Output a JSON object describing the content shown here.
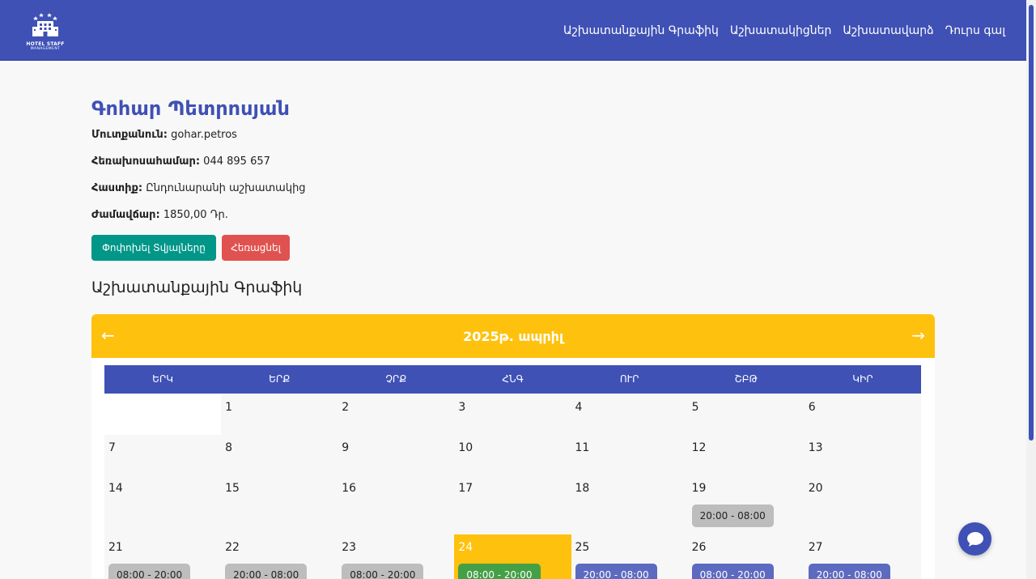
{
  "nav": {
    "logo_name": "HOTEL STAFF",
    "logo_sub": "MANAGEMENT",
    "links": [
      "Աշխատանքային Գրաֆիկ",
      "Աշխատակիցներ",
      "Աշխատավարձ",
      "Դուրս գալ"
    ]
  },
  "profile": {
    "name": "Գոհար Պետրոսյան",
    "fields": [
      {
        "label": "Մուտքանուն:",
        "value": "gohar.petros"
      },
      {
        "label": "Հեռախոսահամար:",
        "value": "044 895 657"
      },
      {
        "label": "Հաստիք:",
        "value": "Ընդունարանի աշխատակից"
      },
      {
        "label": "Ժամավճար:",
        "value": "1850,00 Դր."
      }
    ],
    "edit_label": "Փոփոխել Տվյալները",
    "delete_label": "Հեռացնել"
  },
  "schedule": {
    "section_title": "Աշխատանքային Գրաֆիկ",
    "month_label": "2025թ. ապրիլ",
    "prev_icon": "←",
    "next_icon": "→",
    "weekdays": [
      "ԵՐԿ",
      "ԵՐՔ",
      "ՉՐՔ",
      "ՀՆԳ",
      "ՈՒՐ",
      "ՇԲԹ",
      "ԿԻՐ"
    ],
    "days": [
      {
        "day": "",
        "empty": true
      },
      {
        "day": "1"
      },
      {
        "day": "2"
      },
      {
        "day": "3"
      },
      {
        "day": "4"
      },
      {
        "day": "5"
      },
      {
        "day": "6"
      },
      {
        "day": "7"
      },
      {
        "day": "8"
      },
      {
        "day": "9"
      },
      {
        "day": "10"
      },
      {
        "day": "11"
      },
      {
        "day": "12"
      },
      {
        "day": "13"
      },
      {
        "day": "14"
      },
      {
        "day": "15"
      },
      {
        "day": "16"
      },
      {
        "day": "17"
      },
      {
        "day": "18"
      },
      {
        "day": "19",
        "shift": "20:00 - 08:00",
        "shift_style": "grey"
      },
      {
        "day": "20"
      },
      {
        "day": "21",
        "shift": "08:00 - 20:00",
        "shift_style": "grey"
      },
      {
        "day": "22",
        "shift": "20:00 - 08:00",
        "shift_style": "grey"
      },
      {
        "day": "23",
        "shift": "08:00 - 20:00",
        "shift_style": "grey"
      },
      {
        "day": "24",
        "shift": "08:00 - 20:00",
        "shift_style": "green",
        "today": true
      },
      {
        "day": "25",
        "shift": "20:00 - 08:00",
        "shift_style": "blue"
      },
      {
        "day": "26",
        "shift": "08:00 - 20:00",
        "shift_style": "blue"
      },
      {
        "day": "27",
        "shift": "20:00 - 08:00",
        "shift_style": "blue"
      }
    ]
  },
  "colors": {
    "primary": "#3f51b5",
    "accent": "#fec10d",
    "edit_button": "#009688",
    "delete_button": "#e0524f"
  },
  "icons": {
    "logo": "hotel-building-icon",
    "chat": "chat-bubble-icon"
  }
}
